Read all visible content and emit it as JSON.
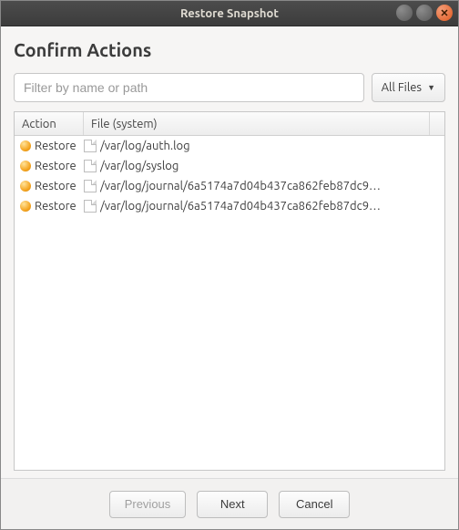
{
  "window": {
    "title": "Restore Snapshot"
  },
  "page": {
    "heading": "Confirm Actions"
  },
  "filter": {
    "placeholder": "Filter by name or path",
    "dropdown_label": "All Files"
  },
  "table": {
    "headers": {
      "action": "Action",
      "file": "File (system)"
    },
    "rows": [
      {
        "action": "Restore",
        "path": "/var/log/auth.log"
      },
      {
        "action": "Restore",
        "path": "/var/log/syslog"
      },
      {
        "action": "Restore",
        "path": "/var/log/journal/6a5174a7d04b437ca862feb87dc9…"
      },
      {
        "action": "Restore",
        "path": "/var/log/journal/6a5174a7d04b437ca862feb87dc9…"
      }
    ]
  },
  "buttons": {
    "previous": "Previous",
    "next": "Next",
    "cancel": "Cancel"
  }
}
